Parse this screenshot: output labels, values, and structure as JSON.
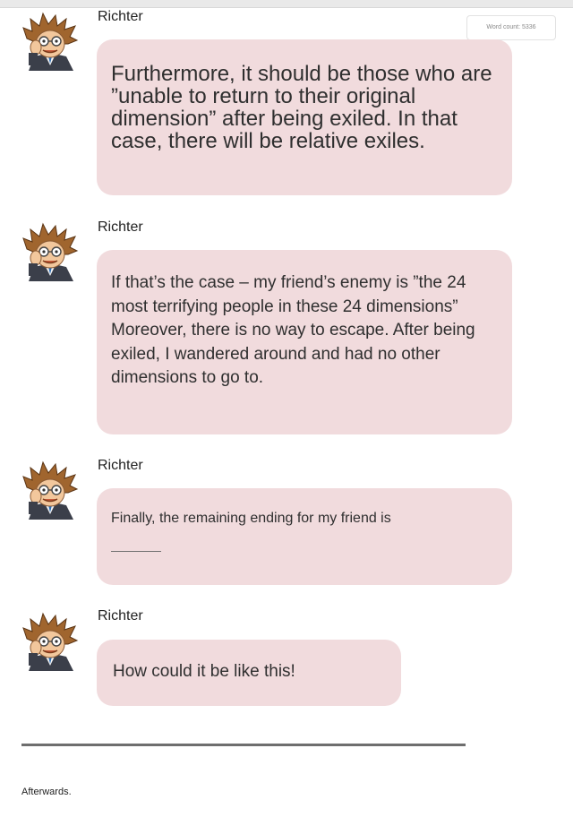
{
  "header": {
    "word_count_label": "Word count: 5336"
  },
  "messages": [
    {
      "sender": "Richter",
      "text": "Furthermore, it should be those who are ”unable to return to their original dimension” after being exiled. In that case, there will be relative exiles."
    },
    {
      "sender": "Richter",
      "text": "If that’s the case – my friend’s enemy is ”the 24 most terrifying people in these 24 dimensions” Moreover, there is no way to escape. After being exiled, I wandered around and had no other dimensions to go to."
    },
    {
      "sender": "Richter",
      "text": "Finally, the remaining ending for my friend is"
    },
    {
      "sender": "Richter",
      "text": "How could it be like this!"
    }
  ],
  "footer": {
    "text": "Afterwards."
  },
  "colors": {
    "bubble": "#f1dbdd",
    "divider": "#6e6e6e"
  },
  "icons": {
    "avatar": "richter-avatar-icon"
  }
}
